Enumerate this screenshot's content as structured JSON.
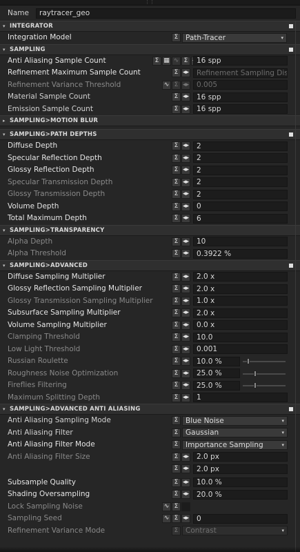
{
  "name_row": {
    "label": "Name",
    "value": "raytracer_geo"
  },
  "icons": {
    "sigma": "Σ",
    "link": "◂▸",
    "wave": "∿",
    "grid": "▦",
    "chevron": "▾",
    "tri_open": "▾",
    "tri_closed": "▸"
  },
  "sections": {
    "integrator": "INTEGRATOR",
    "sampling": "SAMPLING",
    "motion_blur": "SAMPLING>MOTION BLUR",
    "path_depths": "SAMPLING>PATH DEPTHS",
    "transparency": "SAMPLING>TRANSPARENCY",
    "advanced": "SAMPLING>ADVANCED",
    "advanced_aa": "SAMPLING>ADVANCED ANTI ALIASING"
  },
  "integrator": {
    "integration_model": {
      "label": "Integration Model",
      "value": "Path-Tracer"
    }
  },
  "sampling": {
    "aa_count": {
      "label": "Anti Aliasing Sample Count",
      "value": "16 spp"
    },
    "ref_max": {
      "label": "Refinement Maximum Sample Count",
      "value": "Refinement Sampling Disabl"
    },
    "ref_var": {
      "label": "Refinement Variance Threshold",
      "value": "0.005"
    },
    "material": {
      "label": "Material Sample Count",
      "value": "16 spp"
    },
    "emission": {
      "label": "Emission Sample Count",
      "value": "16 spp"
    }
  },
  "path_depths": {
    "diffuse": {
      "label": "Diffuse Depth",
      "value": "2"
    },
    "spec_refl": {
      "label": "Specular Reflection Depth",
      "value": "2"
    },
    "glossy_refl": {
      "label": "Glossy Reflection Depth",
      "value": "2"
    },
    "spec_trans": {
      "label": "Specular Transmission Depth",
      "value": "2"
    },
    "glossy_trans": {
      "label": "Glossy Transmission Depth",
      "value": "2"
    },
    "volume": {
      "label": "Volume Depth",
      "value": "0"
    },
    "total": {
      "label": "Total Maximum Depth",
      "value": "6"
    }
  },
  "transparency": {
    "alpha_depth": {
      "label": "Alpha Depth",
      "value": "10"
    },
    "alpha_threshold": {
      "label": "Alpha Threshold",
      "value": "0.3922 %"
    }
  },
  "advanced": {
    "diffuse_mult": {
      "label": "Diffuse Sampling Multiplier",
      "value": "2.0 x"
    },
    "glossy_refl_mult": {
      "label": "Glossy Reflection Sampling Multiplier",
      "value": "2.0 x"
    },
    "glossy_trans_mult": {
      "label": "Glossy Transmission Sampling Multiplier",
      "value": "1.0 x"
    },
    "subsurface_mult": {
      "label": "Subsurface Sampling Multiplier",
      "value": "2.0 x"
    },
    "volume_mult": {
      "label": "Volume Sampling Multiplier",
      "value": "0.0 x"
    },
    "clamping": {
      "label": "Clamping Threshold",
      "value": "10.0"
    },
    "low_light": {
      "label": "Low Light Threshold",
      "value": "0.001"
    },
    "russian": {
      "label": "Russian Roulette",
      "value": "10.0 %",
      "level": 0.1
    },
    "roughness": {
      "label": "Roughness Noise Optimization",
      "value": "25.0 %",
      "level": 0.25
    },
    "fireflies": {
      "label": "Fireflies Filtering",
      "value": "25.0 %",
      "level": 0.25
    },
    "max_split": {
      "label": "Maximum Splitting Depth",
      "value": "1"
    }
  },
  "advanced_aa": {
    "aa_mode": {
      "label": "Anti Aliasing Sampling Mode",
      "value": "Blue Noise"
    },
    "aa_filter": {
      "label": "Anti Aliasing Filter",
      "value": "Gaussian"
    },
    "aa_filter_mode": {
      "label": "Anti Aliasing Filter Mode",
      "value": "Importance Sampling"
    },
    "aa_filter_size": {
      "label": "Anti Aliasing Filter Size",
      "value_x": "2.0 px",
      "value_y": "2.0 px"
    },
    "subsample": {
      "label": "Subsample Quality",
      "value": "10.0 %"
    },
    "shading_over": {
      "label": "Shading Oversampling",
      "value": "20.0 %"
    },
    "lock_noise": {
      "label": "Lock Sampling Noise"
    },
    "seed": {
      "label": "Sampling Seed",
      "value": "0"
    },
    "ref_var_mode": {
      "label": "Refinement Variance Mode",
      "value": "Contrast"
    }
  }
}
